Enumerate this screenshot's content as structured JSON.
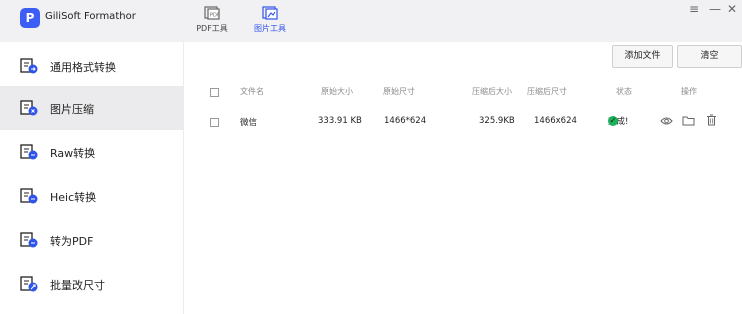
{
  "app": {
    "title": "GiliSoft Formathor",
    "logo_letter": "P"
  },
  "toolbar": {
    "tools": [
      {
        "label": "PDF工具"
      },
      {
        "label": "图片工具"
      }
    ]
  },
  "sidebar": {
    "items": [
      {
        "label": "通用格式转换"
      },
      {
        "label": "图片压缩"
      },
      {
        "label": "Raw转换"
      },
      {
        "label": "Heic转换"
      },
      {
        "label": "转为PDF"
      },
      {
        "label": "批量改尺寸"
      }
    ],
    "active_index": 1
  },
  "actions": {
    "add_file": "添加文件",
    "clear": "清空"
  },
  "table": {
    "headers": {
      "filename": "文件名",
      "orig_size": "原始大小",
      "orig_dim": "原始尺寸",
      "comp_size": "压缩后大小",
      "comp_dim": "压缩后尺寸",
      "status": "状态",
      "ops": "操作"
    },
    "rows": [
      {
        "filename": "微信",
        "orig_size": "333.91 KB",
        "orig_dim": "1466*624",
        "comp_size": "325.9KB",
        "comp_dim": "1466x624",
        "status": "完成!"
      }
    ]
  },
  "colors": {
    "accent": "#2f54eb",
    "success": "#19b15a",
    "active_bg": "#ebebed"
  }
}
